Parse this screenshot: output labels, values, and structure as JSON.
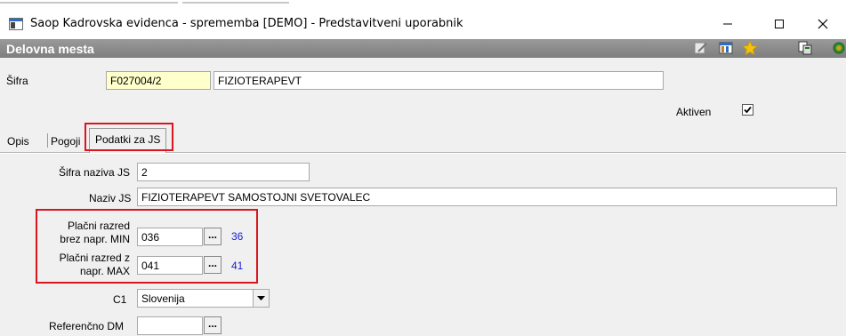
{
  "window": {
    "title": "Saop Kadrovska evidenca - sprememba [DEMO] - Predstavitveni uporabnik",
    "minimize_icon": "minimize-icon",
    "maximize_icon": "maximize-icon",
    "close_icon": "close-icon"
  },
  "header": {
    "title": "Delovna mesta",
    "toolbar_icons": [
      "edit-icon",
      "columns-icon",
      "star-icon",
      "export-icon",
      "exit-icon"
    ]
  },
  "form": {
    "sifra_label": "Šifra",
    "sifra_code": "F027004/2",
    "sifra_name": "FIZIOTERAPEVT",
    "aktiven_label": "Aktiven",
    "aktiven_checked": true
  },
  "tabs": [
    {
      "label": "Opis",
      "active": false
    },
    {
      "label": "Pogoji",
      "active": false
    },
    {
      "label": "Podatki za JS",
      "active": true
    }
  ],
  "js": {
    "sifra_naziva_label": "Šifra naziva JS",
    "sifra_naziva_value": "2",
    "naziv_label": "Naziv JS",
    "naziv_value": "FIZIOTERAPEVT SAMOSTOJNI SVETOVALEC",
    "min_label_line1": "Plačni razred",
    "min_label_line2": "brez napr. MIN",
    "min_value": "036",
    "min_display": "36",
    "max_label_line1": "Plačni razred z",
    "max_label_line2": "napr. MAX",
    "max_value": "041",
    "max_display": "41",
    "c1_label": "C1",
    "c1_value": "Slovenija",
    "referencno_label": "Referenčno DM",
    "referencno_value": "",
    "ellipsis": "..."
  },
  "colors": {
    "highlight": "#d9151f",
    "blue_value": "#1a1ad6",
    "header_bg": "#8a8a8a",
    "code_field_bg": "#ffffcc"
  }
}
